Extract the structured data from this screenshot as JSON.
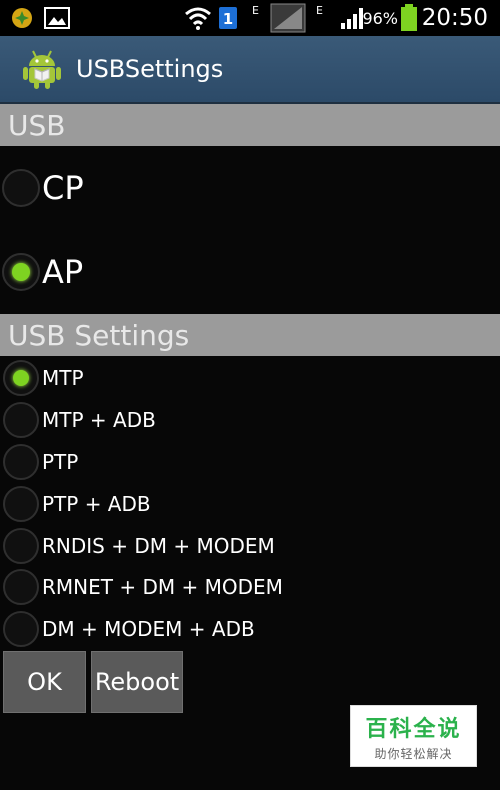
{
  "status_bar": {
    "battery_percent": "96%",
    "time": "20:50",
    "sim_badge": "1",
    "network_letter_1": "E",
    "network_letter_2": "E",
    "icons": [
      "app-notification-icon",
      "image-notification-icon",
      "wifi-icon",
      "sim-icon",
      "signal-icon",
      "signal-icon",
      "battery-icon"
    ]
  },
  "app_bar": {
    "title": "USBSettings",
    "icon": "android-icon"
  },
  "usb_section": {
    "header": "USB",
    "options": [
      {
        "label": "CP",
        "selected": false
      },
      {
        "label": "AP",
        "selected": true
      }
    ]
  },
  "usb_settings_section": {
    "header": "USB Settings",
    "options": [
      {
        "label": "MTP",
        "selected": true
      },
      {
        "label": "MTP + ADB",
        "selected": false
      },
      {
        "label": "PTP",
        "selected": false
      },
      {
        "label": "PTP + ADB",
        "selected": false
      },
      {
        "label": "RNDIS + DM + MODEM",
        "selected": false
      },
      {
        "label": "RMNET + DM + MODEM",
        "selected": false
      },
      {
        "label": "DM + MODEM + ADB",
        "selected": false
      }
    ]
  },
  "buttons": {
    "ok": "OK",
    "reboot": "Reboot"
  },
  "watermark": {
    "title": "百科全说",
    "subtitle": "助你轻松解决"
  },
  "colors": {
    "accent": "#7ed321",
    "app_bar": "#34536f",
    "section_bg": "#9b9b9b",
    "battery": "#7ed321"
  }
}
